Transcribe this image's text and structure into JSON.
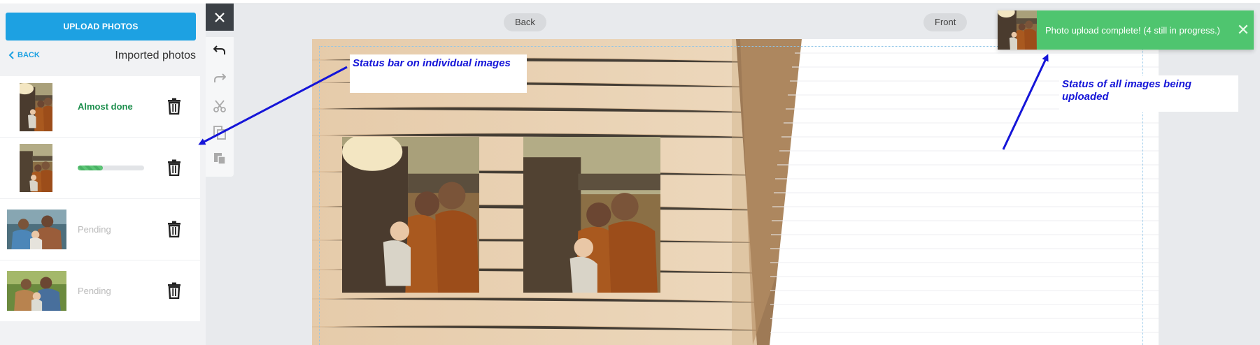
{
  "sidebar": {
    "upload_button": "UPLOAD PHOTOS",
    "back_label": "BACK",
    "title": "Imported photos",
    "photos": [
      {
        "status": "Almost done",
        "state": "done"
      },
      {
        "status": "",
        "state": "uploading",
        "progress": 0.38
      },
      {
        "status": "Pending",
        "state": "pending"
      },
      {
        "status": "Pending",
        "state": "pending"
      }
    ]
  },
  "tools": [
    "close-icon",
    "undo-icon",
    "redo-icon",
    "cut-icon",
    "copy-icon",
    "paste-icon"
  ],
  "canvas": {
    "back_label": "Back",
    "front_label": "Front"
  },
  "annotations": {
    "individual": "Status bar on individual images",
    "overall": "Status of all images being uploaded",
    "arrow_color": "#1515d8"
  },
  "toast": {
    "message": "Photo upload complete! (4 still in progress.)",
    "close": "✕",
    "color": "#4fc56f"
  },
  "colors": {
    "accent": "#1da1e2",
    "success": "#1e8f4e",
    "pending": "#bbbbbb",
    "wood": "#e8cfb1"
  }
}
